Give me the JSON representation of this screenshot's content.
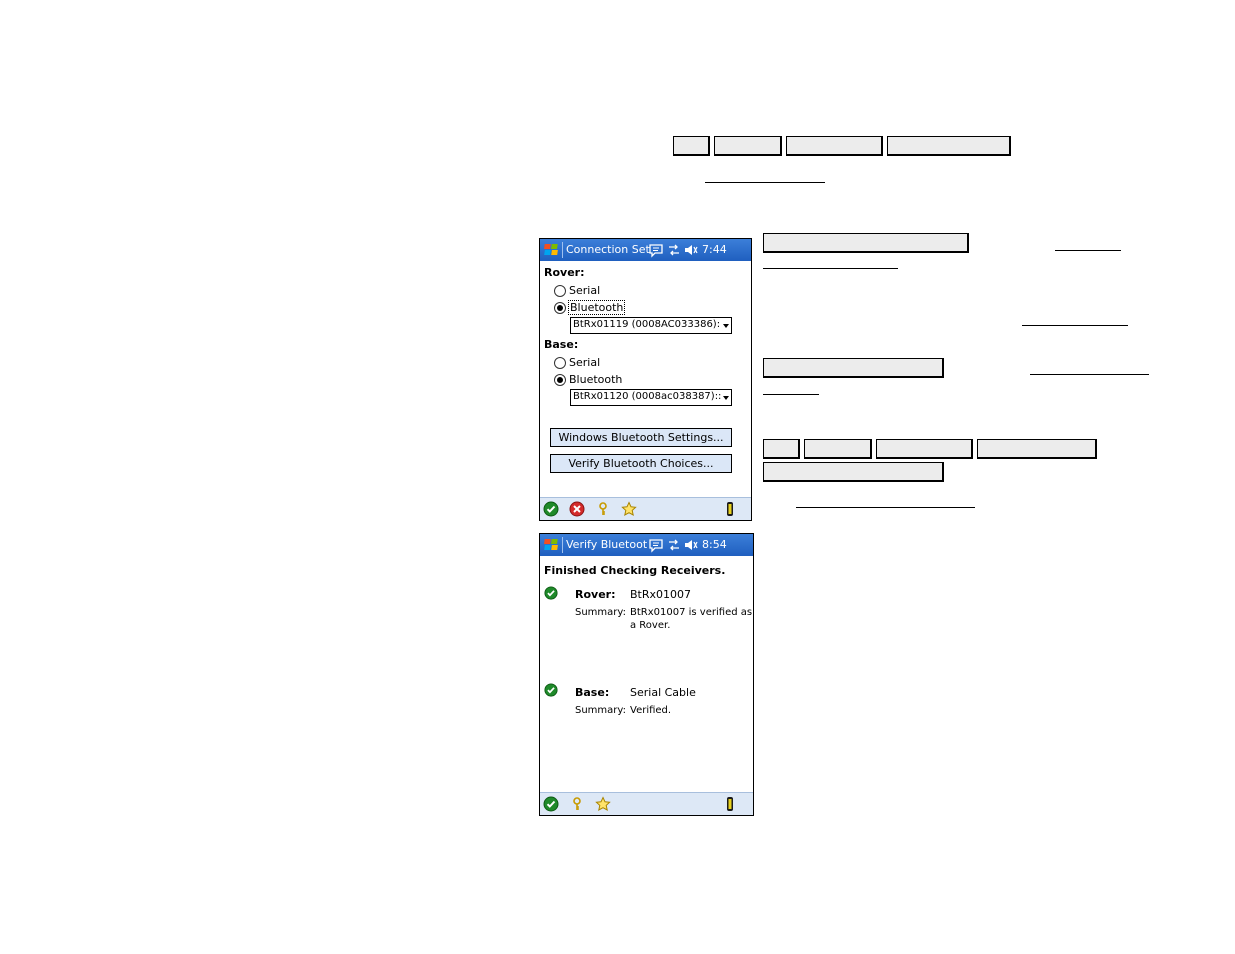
{
  "screen1": {
    "title": "Connection Set",
    "clock": "7:44",
    "rover_label": "Rover:",
    "base_label": "Base:",
    "serial_label": "Serial",
    "bluetooth_label": "Bluetooth",
    "rover_device": "BtRx01119 (0008AC033386):",
    "base_device": "BtRx01120 (0008ac038387)::",
    "windows_bt_button": "Windows Bluetooth Settings...",
    "verify_bt_button": "Verify Bluetooth Choices...",
    "rover_selected": "Bluetooth",
    "base_selected": "Bluetooth"
  },
  "screen2": {
    "title": "Verify Bluetoot",
    "clock": "8:54",
    "heading": "Finished Checking Receivers.",
    "rover_label": "Rover:",
    "rover_value": "BtRx01007",
    "summary_label": "Summary:",
    "rover_summary_line1": "BtRx01007 is verified as",
    "rover_summary_line2": "a Rover.",
    "base_label": "Base:",
    "base_value": "Serial Cable",
    "base_summary": "Verified."
  },
  "icons": {
    "ok": "check-circle-icon",
    "cancel": "x-circle-icon",
    "help": "key-icon",
    "favorite": "star-icon",
    "receiver": "receiver-icon"
  },
  "colors": {
    "titlebar": "#1f5fbf",
    "bottombar": "#dde8f6",
    "doc_button_fill": "#ececec"
  }
}
